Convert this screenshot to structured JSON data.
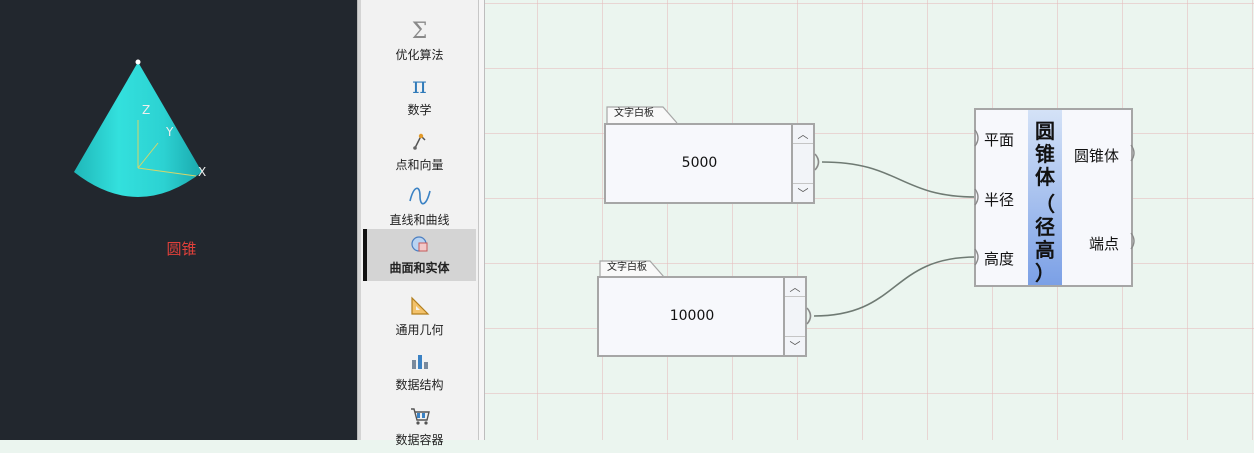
{
  "preview": {
    "caption": "圆锥",
    "axis_labels": [
      "Z",
      "Y",
      "X"
    ],
    "colors": {
      "background": "#22272e",
      "cone": "#2fd6d6",
      "caption": "#e0403a"
    }
  },
  "palette": {
    "items": [
      {
        "label": "优化算法",
        "icon": "sigma-icon"
      },
      {
        "label": "数学",
        "icon": "pi-icon"
      },
      {
        "label": "点和向量",
        "icon": "point-vector-icon"
      },
      {
        "label": "直线和曲线",
        "icon": "curve-icon"
      },
      {
        "label": "曲面和实体",
        "icon": "surface-solid-icon",
        "active": true
      },
      {
        "label": "通用几何",
        "icon": "set-square-icon"
      },
      {
        "label": "数据结构",
        "icon": "bar-chart-icon"
      },
      {
        "label": "数据容器",
        "icon": "cart-icon"
      }
    ]
  },
  "canvas": {
    "text_nodes": [
      {
        "tab": "文字白板",
        "value": "5000"
      },
      {
        "tab": "文字白板",
        "value": "10000"
      }
    ],
    "cone_node": {
      "title": [
        "圆",
        "锥",
        "体",
        "（",
        "径",
        "高",
        "）"
      ],
      "inputs": [
        "平面",
        "半径",
        "高度"
      ],
      "outputs": [
        "圆锥体",
        "端点"
      ]
    }
  }
}
